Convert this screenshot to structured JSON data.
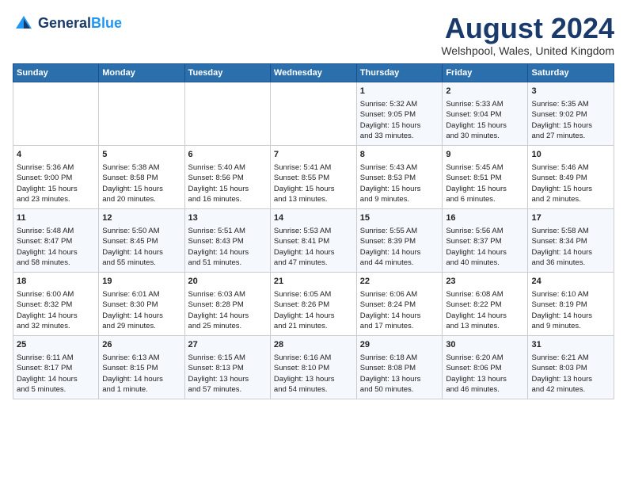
{
  "header": {
    "logo_line1": "General",
    "logo_line2": "Blue",
    "month": "August 2024",
    "location": "Welshpool, Wales, United Kingdom"
  },
  "days_of_week": [
    "Sunday",
    "Monday",
    "Tuesday",
    "Wednesday",
    "Thursday",
    "Friday",
    "Saturday"
  ],
  "weeks": [
    [
      {
        "day": "",
        "text": ""
      },
      {
        "day": "",
        "text": ""
      },
      {
        "day": "",
        "text": ""
      },
      {
        "day": "",
        "text": ""
      },
      {
        "day": "1",
        "text": "Sunrise: 5:32 AM\nSunset: 9:05 PM\nDaylight: 15 hours\nand 33 minutes."
      },
      {
        "day": "2",
        "text": "Sunrise: 5:33 AM\nSunset: 9:04 PM\nDaylight: 15 hours\nand 30 minutes."
      },
      {
        "day": "3",
        "text": "Sunrise: 5:35 AM\nSunset: 9:02 PM\nDaylight: 15 hours\nand 27 minutes."
      }
    ],
    [
      {
        "day": "4",
        "text": "Sunrise: 5:36 AM\nSunset: 9:00 PM\nDaylight: 15 hours\nand 23 minutes."
      },
      {
        "day": "5",
        "text": "Sunrise: 5:38 AM\nSunset: 8:58 PM\nDaylight: 15 hours\nand 20 minutes."
      },
      {
        "day": "6",
        "text": "Sunrise: 5:40 AM\nSunset: 8:56 PM\nDaylight: 15 hours\nand 16 minutes."
      },
      {
        "day": "7",
        "text": "Sunrise: 5:41 AM\nSunset: 8:55 PM\nDaylight: 15 hours\nand 13 minutes."
      },
      {
        "day": "8",
        "text": "Sunrise: 5:43 AM\nSunset: 8:53 PM\nDaylight: 15 hours\nand 9 minutes."
      },
      {
        "day": "9",
        "text": "Sunrise: 5:45 AM\nSunset: 8:51 PM\nDaylight: 15 hours\nand 6 minutes."
      },
      {
        "day": "10",
        "text": "Sunrise: 5:46 AM\nSunset: 8:49 PM\nDaylight: 15 hours\nand 2 minutes."
      }
    ],
    [
      {
        "day": "11",
        "text": "Sunrise: 5:48 AM\nSunset: 8:47 PM\nDaylight: 14 hours\nand 58 minutes."
      },
      {
        "day": "12",
        "text": "Sunrise: 5:50 AM\nSunset: 8:45 PM\nDaylight: 14 hours\nand 55 minutes."
      },
      {
        "day": "13",
        "text": "Sunrise: 5:51 AM\nSunset: 8:43 PM\nDaylight: 14 hours\nand 51 minutes."
      },
      {
        "day": "14",
        "text": "Sunrise: 5:53 AM\nSunset: 8:41 PM\nDaylight: 14 hours\nand 47 minutes."
      },
      {
        "day": "15",
        "text": "Sunrise: 5:55 AM\nSunset: 8:39 PM\nDaylight: 14 hours\nand 44 minutes."
      },
      {
        "day": "16",
        "text": "Sunrise: 5:56 AM\nSunset: 8:37 PM\nDaylight: 14 hours\nand 40 minutes."
      },
      {
        "day": "17",
        "text": "Sunrise: 5:58 AM\nSunset: 8:34 PM\nDaylight: 14 hours\nand 36 minutes."
      }
    ],
    [
      {
        "day": "18",
        "text": "Sunrise: 6:00 AM\nSunset: 8:32 PM\nDaylight: 14 hours\nand 32 minutes."
      },
      {
        "day": "19",
        "text": "Sunrise: 6:01 AM\nSunset: 8:30 PM\nDaylight: 14 hours\nand 29 minutes."
      },
      {
        "day": "20",
        "text": "Sunrise: 6:03 AM\nSunset: 8:28 PM\nDaylight: 14 hours\nand 25 minutes."
      },
      {
        "day": "21",
        "text": "Sunrise: 6:05 AM\nSunset: 8:26 PM\nDaylight: 14 hours\nand 21 minutes."
      },
      {
        "day": "22",
        "text": "Sunrise: 6:06 AM\nSunset: 8:24 PM\nDaylight: 14 hours\nand 17 minutes."
      },
      {
        "day": "23",
        "text": "Sunrise: 6:08 AM\nSunset: 8:22 PM\nDaylight: 14 hours\nand 13 minutes."
      },
      {
        "day": "24",
        "text": "Sunrise: 6:10 AM\nSunset: 8:19 PM\nDaylight: 14 hours\nand 9 minutes."
      }
    ],
    [
      {
        "day": "25",
        "text": "Sunrise: 6:11 AM\nSunset: 8:17 PM\nDaylight: 14 hours\nand 5 minutes."
      },
      {
        "day": "26",
        "text": "Sunrise: 6:13 AM\nSunset: 8:15 PM\nDaylight: 14 hours\nand 1 minute."
      },
      {
        "day": "27",
        "text": "Sunrise: 6:15 AM\nSunset: 8:13 PM\nDaylight: 13 hours\nand 57 minutes."
      },
      {
        "day": "28",
        "text": "Sunrise: 6:16 AM\nSunset: 8:10 PM\nDaylight: 13 hours\nand 54 minutes."
      },
      {
        "day": "29",
        "text": "Sunrise: 6:18 AM\nSunset: 8:08 PM\nDaylight: 13 hours\nand 50 minutes."
      },
      {
        "day": "30",
        "text": "Sunrise: 6:20 AM\nSunset: 8:06 PM\nDaylight: 13 hours\nand 46 minutes."
      },
      {
        "day": "31",
        "text": "Sunrise: 6:21 AM\nSunset: 8:03 PM\nDaylight: 13 hours\nand 42 minutes."
      }
    ]
  ]
}
